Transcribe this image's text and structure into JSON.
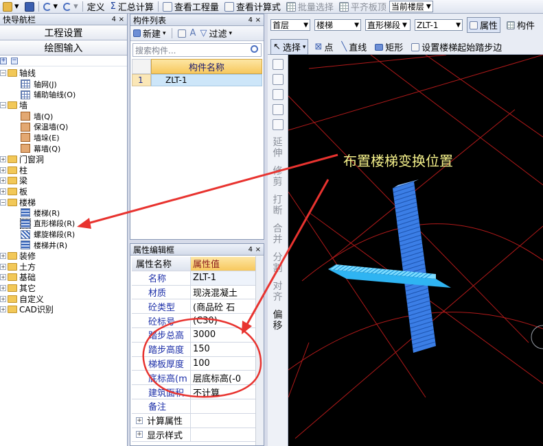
{
  "toolbar": {
    "define": "定义",
    "summary": "汇总计算",
    "view_qty": "查看工程量",
    "view_formula": "查看计算式",
    "batch_select": "批量选择",
    "align_top": "平齐板顶",
    "current_floor": "当前楼层"
  },
  "nav": {
    "title": "快导航栏",
    "pin": "4",
    "close": "×",
    "project_settings": "工程设置",
    "drawing_input": "绘图输入",
    "tree": [
      {
        "label": "轴线",
        "expanded": true,
        "children": [
          {
            "label": "轴网(J)",
            "icon": "grid-icon"
          },
          {
            "label": "辅助轴线(O)",
            "icon": "aux-axis-icon"
          }
        ]
      },
      {
        "label": "墙",
        "expanded": true,
        "children": [
          {
            "label": "墙(Q)",
            "icon": "wall-icon"
          },
          {
            "label": "保温墙(Q)",
            "icon": "insulation-wall-icon"
          },
          {
            "label": "墙垛(E)",
            "icon": "wall-pier-icon"
          },
          {
            "label": "幕墙(Q)",
            "icon": "curtain-wall-icon"
          }
        ]
      },
      {
        "label": "门窗洞",
        "expanded": false,
        "children": []
      },
      {
        "label": "柱",
        "expanded": false,
        "children": []
      },
      {
        "label": "梁",
        "expanded": false,
        "children": []
      },
      {
        "label": "板",
        "expanded": false,
        "children": []
      },
      {
        "label": "楼梯",
        "expanded": true,
        "children": [
          {
            "label": "楼梯(R)",
            "icon": "stair-icon"
          },
          {
            "label": "直形梯段(R)",
            "icon": "straight-flight-icon"
          },
          {
            "label": "螺旋梯段(R)",
            "icon": "spiral-flight-icon"
          },
          {
            "label": "楼梯井(R)",
            "icon": "stairwell-icon"
          }
        ]
      },
      {
        "label": "装修",
        "expanded": false,
        "children": []
      },
      {
        "label": "土方",
        "expanded": false,
        "children": []
      },
      {
        "label": "基础",
        "expanded": false,
        "children": []
      },
      {
        "label": "其它",
        "expanded": false,
        "children": []
      },
      {
        "label": "自定义",
        "expanded": false,
        "children": []
      },
      {
        "label": "CAD识别",
        "expanded": false,
        "children": []
      }
    ]
  },
  "component_list": {
    "title": "构件列表",
    "new_label": "新建",
    "filter_label": "过滤",
    "search_placeholder": "搜索构件...",
    "column_header": "构件名称",
    "rows": [
      {
        "index": "1",
        "name": "ZLT-1"
      }
    ]
  },
  "properties": {
    "title": "属性编辑框",
    "header_name": "属性名称",
    "header_value": "属性值",
    "rows": [
      {
        "name": "名称",
        "value": "ZLT-1"
      },
      {
        "name": "材质",
        "value": "现浇混凝土"
      },
      {
        "name": "砼类型",
        "value": "(商品砼 石"
      },
      {
        "name": "砼标号",
        "value": "(C30)"
      },
      {
        "name": "踏步总高",
        "value": "3000"
      },
      {
        "name": "踏步高度",
        "value": "150"
      },
      {
        "name": "梯板厚度",
        "value": "100"
      },
      {
        "name": "底标高(m",
        "value": "层底标高(-0"
      },
      {
        "name": "建筑面积",
        "value": "不计算"
      },
      {
        "name": "备注",
        "value": ""
      }
    ],
    "groups": [
      {
        "name": "计算属性"
      },
      {
        "name": "显示样式"
      }
    ]
  },
  "viewport": {
    "floor": "首层",
    "category": "楼梯",
    "type": "直形梯段",
    "component": "ZLT-1",
    "properties_btn": "属性",
    "components_btn": "构件",
    "select_label": "选择",
    "point_label": "点",
    "line_label": "直线",
    "rect_label": "矩形",
    "set_start_label": "设置楼梯起始踏步边"
  },
  "vtools": [
    "延伸",
    "修剪",
    "打断",
    "合并",
    "分割",
    "对齐",
    "偏移"
  ],
  "annotation": "布置楼梯变换位置"
}
